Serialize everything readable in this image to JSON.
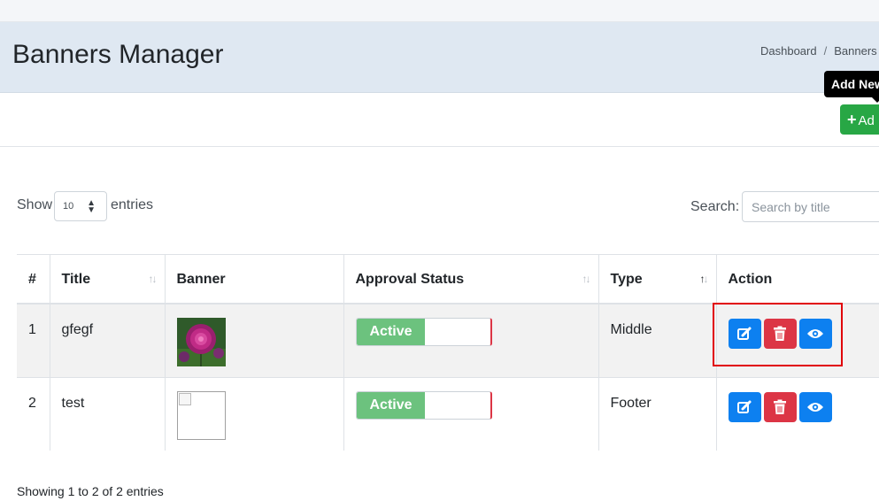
{
  "header": {
    "title": "Banners Manager",
    "breadcrumb": [
      "Dashboard",
      "Banners M"
    ]
  },
  "toolbar": {
    "tooltip": "Add New",
    "add_button_label": "Ad"
  },
  "table_controls": {
    "show_label": "Show",
    "length_value": "10",
    "entries_label": "entries",
    "search_label": "Search:",
    "search_placeholder": "Search by title"
  },
  "table": {
    "columns": [
      "#",
      "Title",
      "Banner",
      "Approval Status",
      "Type",
      "Action"
    ],
    "rows": [
      {
        "num": "1",
        "title": "gfegf",
        "banner": "flower-image",
        "status": "Active",
        "type": "Middle"
      },
      {
        "num": "2",
        "title": "test",
        "banner": "broken-image",
        "status": "Active",
        "type": "Footer"
      }
    ]
  },
  "footer": {
    "info": "Showing 1 to 2 of 2 entries"
  },
  "icons": {
    "edit": "edit-icon",
    "delete": "trash-icon",
    "view": "eye-icon",
    "add": "plus-icon",
    "sort": "sort-arrows-icon"
  },
  "colors": {
    "header_bg": "#dfe8f2",
    "add_button": "#28a745",
    "edit_button": "#0d80f0",
    "delete_button": "#dc3545",
    "view_button": "#0d80f0",
    "active_toggle": "#6cc27e",
    "highlight": "#e1000a"
  }
}
